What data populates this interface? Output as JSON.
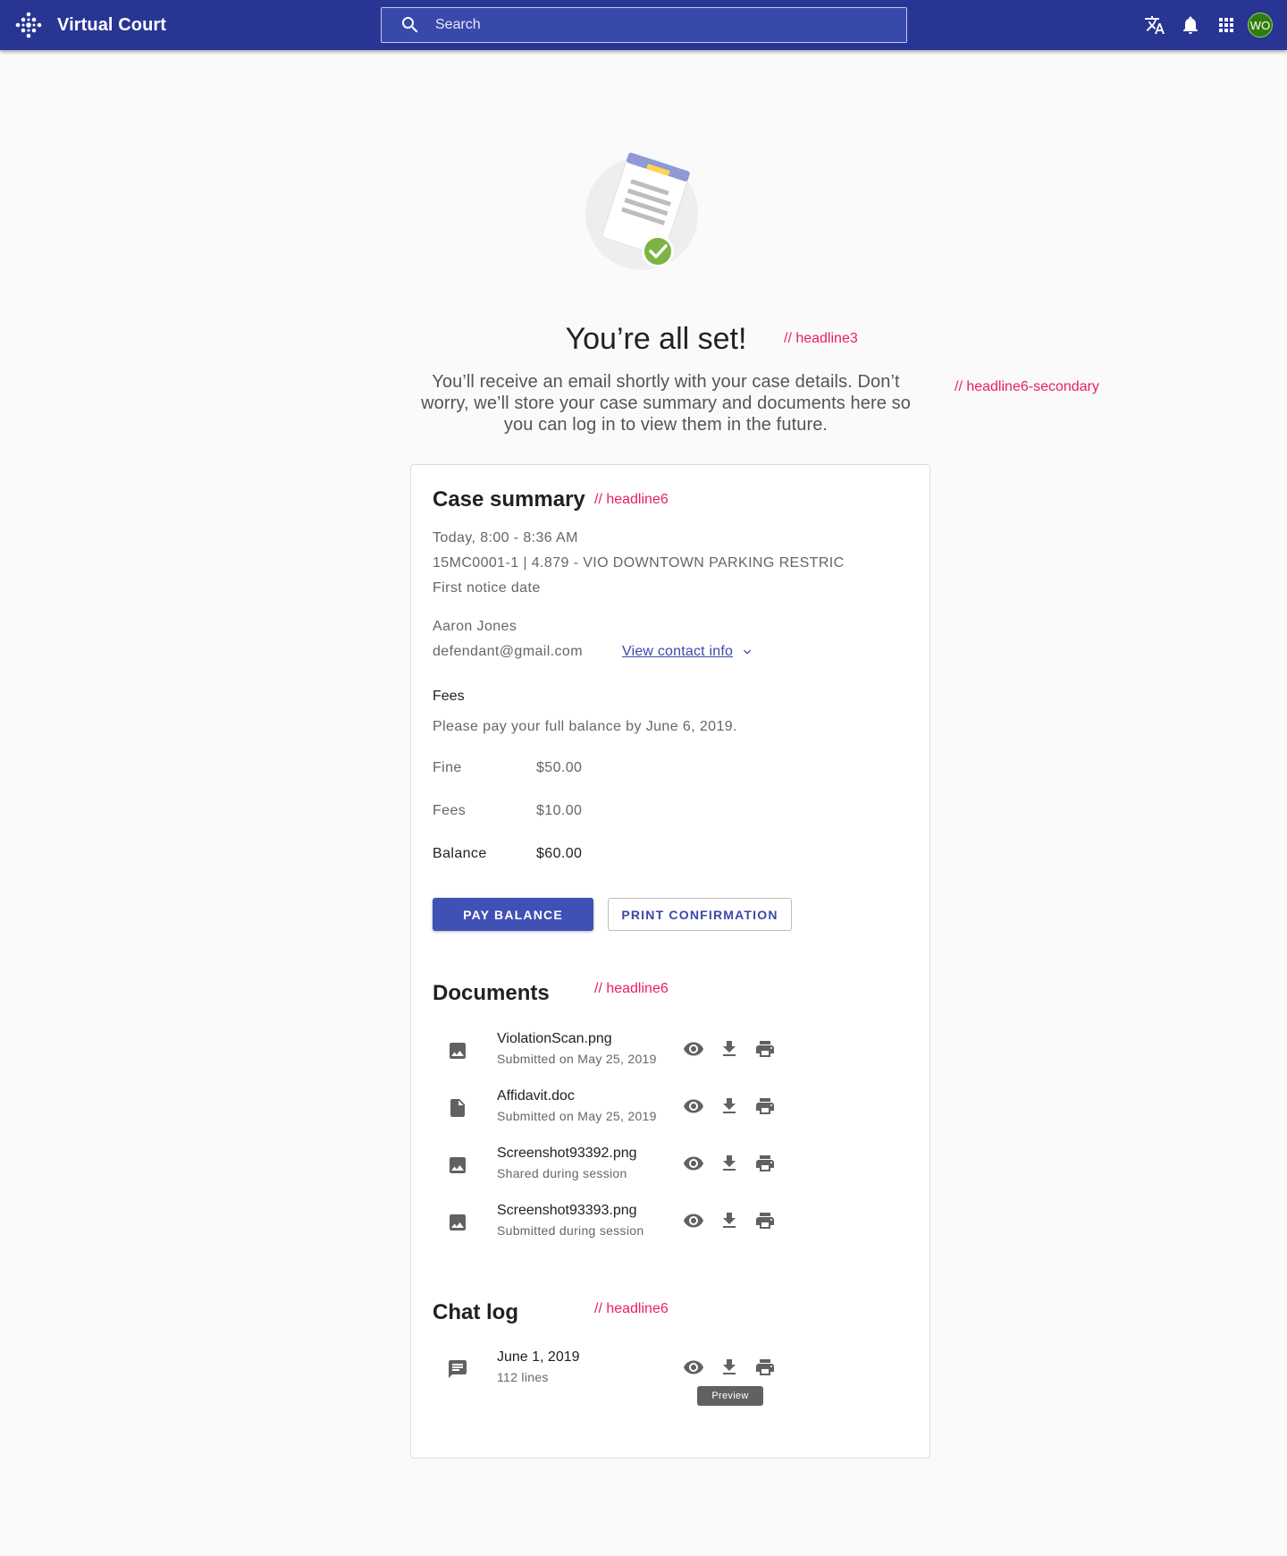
{
  "app": {
    "title": "Virtual Court"
  },
  "search": {
    "placeholder": "Search"
  },
  "user": {
    "initials": "WO"
  },
  "hero": {
    "title": "You’re all set!",
    "subtitle": "You’ll receive an email shortly with your case details. Don’t worry,  we’ll store your case summary and documents here so you can log in to view them in the future."
  },
  "annotations": {
    "title_style": "// headline3",
    "subtitle_style": "// headline6-secondary",
    "summary_style": "// headline6",
    "documents_style": "// headline6",
    "chat_style": "// headline6"
  },
  "summary": {
    "title": "Case summary",
    "time": "Today, 8:00 - 8:36 AM",
    "case": "15MC0001-1 | 4.879 - VIO DOWNTOWN PARKING RESTRIC",
    "notice": "First notice date",
    "name": "Aaron Jones",
    "email": "defendant@gmail.com",
    "contact_link": "View contact info",
    "fees_heading": "Fees",
    "pay_note": "Please pay your full balance by June 6, 2019.",
    "fees": [
      {
        "label": "Fine",
        "amount": "$50.00"
      },
      {
        "label": "Fees",
        "amount": "$10.00"
      },
      {
        "label": "Balance",
        "amount": "$60.00"
      }
    ],
    "pay_button": "PAY BALANCE",
    "print_button": "PRINT CONFIRMATION"
  },
  "documents": {
    "title": "Documents",
    "items": [
      {
        "name": "ViolationScan.png",
        "sub": "Submitted on May 25, 2019",
        "icon": "image-icon"
      },
      {
        "name": "Affidavit.doc",
        "sub": "Submitted on May 25, 2019",
        "icon": "file-icon"
      },
      {
        "name": "Screenshot93392.png",
        "sub": "Shared during session",
        "icon": "image-icon"
      },
      {
        "name": "Screenshot93393.png",
        "sub": "Submitted during session",
        "icon": "image-icon"
      }
    ]
  },
  "chat": {
    "title": "Chat log",
    "item": {
      "name": "June 1, 2019",
      "sub": "112 lines",
      "icon": "chat-icon"
    },
    "tooltip": "Preview"
  }
}
